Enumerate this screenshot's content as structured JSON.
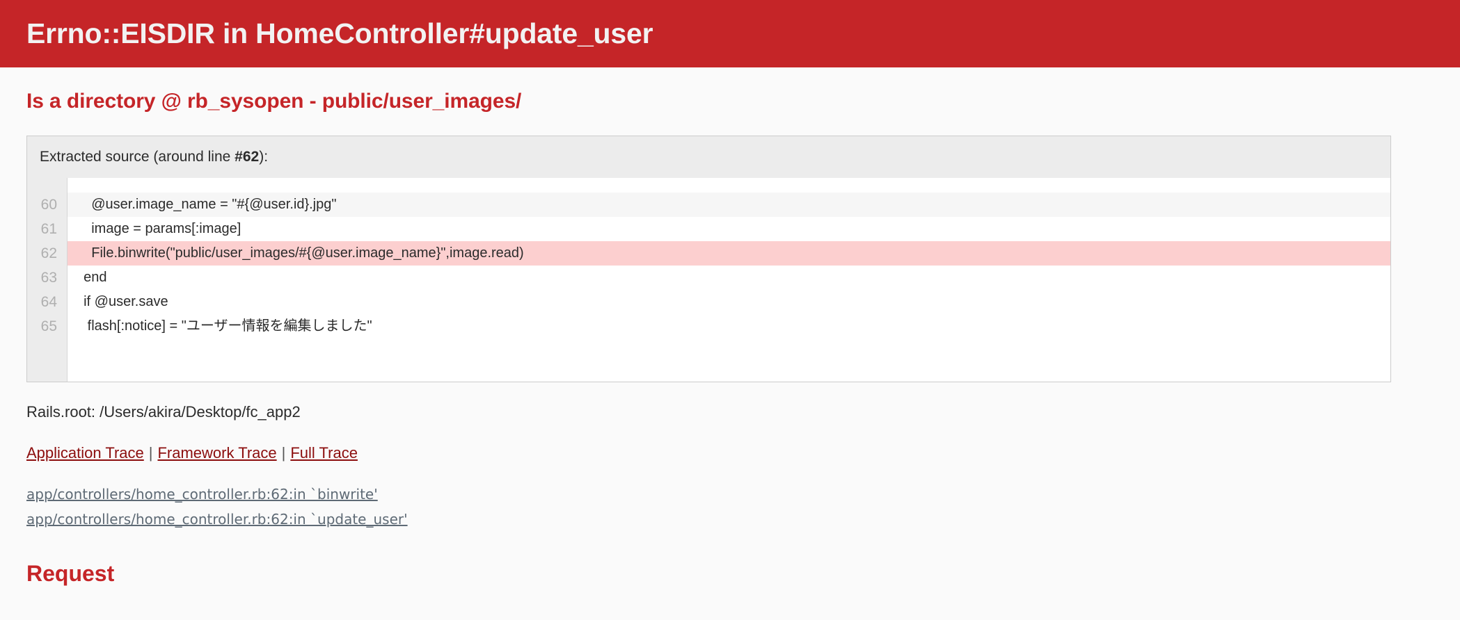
{
  "header": {
    "title": "Errno::EISDIR in HomeController#update_user",
    "bg_color": "#C52528",
    "text_color": "#F2F2F2"
  },
  "error": {
    "message": "Is a directory @ rb_sysopen - public/user_images/",
    "color": "#C52528"
  },
  "source": {
    "title_prefix": "Extracted source (around line ",
    "title_line": "#62",
    "title_suffix": "):",
    "highlight_line": 62,
    "highlight_color": "#FCCFCF",
    "lines": [
      {
        "number": "60",
        "code": "    @user.image_name = \"#{@user.id}.jpg\""
      },
      {
        "number": "61",
        "code": "    image = params[:image]"
      },
      {
        "number": "62",
        "code": "    File.binwrite(\"public/user_images/#{@user.image_name}\",image.read)"
      },
      {
        "number": "63",
        "code": "  end"
      },
      {
        "number": "64",
        "code": "  if @user.save"
      },
      {
        "number": "65",
        "code": "   flash[:notice] = \"ユーザー情報を編集しました\""
      }
    ]
  },
  "rails_root": "Rails.root: /Users/akira/Desktop/fc_app2",
  "trace_links": {
    "separator": "|",
    "items": [
      {
        "label": "Application Trace"
      },
      {
        "label": "Framework Trace"
      },
      {
        "label": "Full Trace"
      }
    ]
  },
  "backtrace": [
    {
      "location": "app/controllers/home_controller.rb:62:in `binwrite'"
    },
    {
      "location": "app/controllers/home_controller.rb:62:in `update_user'"
    }
  ],
  "sections": {
    "request_heading": "Request"
  }
}
